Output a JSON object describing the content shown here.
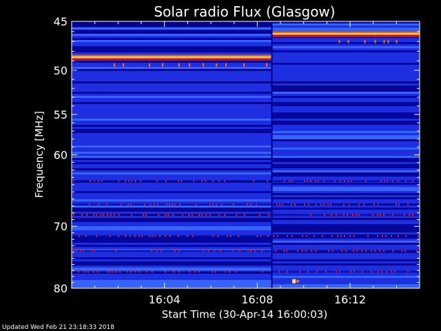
{
  "chart_data": {
    "type": "heatmap",
    "title": "Solar radio Flux (Glasgow)",
    "xlabel": "Start Time (30-Apr-14 16:00:03)",
    "ylabel": "Frequency [MHz]",
    "footer": "Updated Wed Feb 21 23:18:33 2018",
    "x_range_minutes": [
      0,
      15
    ],
    "y_range_mhz": [
      45,
      80
    ],
    "y_scale": "log",
    "x_ticks": [
      {
        "label": "16:04",
        "minute": 4
      },
      {
        "label": "16:08",
        "minute": 8
      },
      {
        "label": "16:12",
        "minute": 12
      }
    ],
    "y_ticks": [
      {
        "label": "45",
        "mhz": 45
      },
      {
        "label": "50",
        "mhz": 50
      },
      {
        "label": "55",
        "mhz": 55
      },
      {
        "label": "60",
        "mhz": 60
      },
      {
        "label": "70",
        "mhz": 70
      },
      {
        "label": "80",
        "mhz": 80
      }
    ],
    "data_gap_minute": 8.6,
    "bright_lines": [
      {
        "mhz": 48.6,
        "from_minute": 0,
        "to_minute": 8.6
      },
      {
        "mhz": 46.2,
        "from_minute": 8.6,
        "to_minute": 15
      }
    ],
    "interference_rows_mhz": [
      63.5,
      66.8,
      68.3,
      71.5,
      73.8,
      77.2
    ],
    "burst": {
      "mhz": 78.8,
      "minute": 9.6
    },
    "colorscale": [
      "#00008a",
      "#1f2ee0",
      "#3b6cff",
      "#c01a3a",
      "#ff6a00",
      "#ffe070"
    ],
    "grid": false
  }
}
